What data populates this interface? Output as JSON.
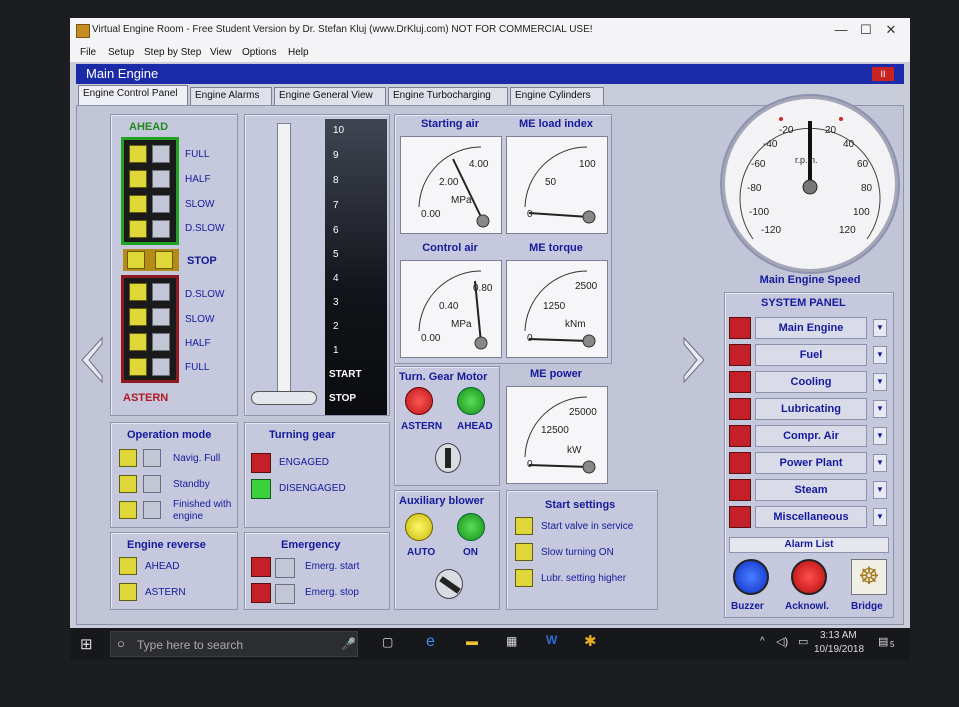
{
  "window": {
    "title": "Virtual Engine Room - Free Student Version by Dr. Stefan Kluj (www.DrKluj.com) NOT FOR COMMERCIAL USE!",
    "minimize": "—",
    "maximize": "☐",
    "close": "✕"
  },
  "menu": [
    "File",
    "Setup",
    "Step by Step",
    "View",
    "Options",
    "Help"
  ],
  "header": {
    "title": "Main Engine",
    "pause": "II"
  },
  "tabs": [
    "Engine Control Panel",
    "Engine Alarms",
    "Engine General View",
    "Engine Turbocharging",
    "Engine Cylinders"
  ],
  "telegraph": {
    "ahead_title": "AHEAD",
    "astern_title": "ASTERN",
    "stop": "STOP",
    "ahead_rows": [
      "FULL",
      "HALF",
      "SLOW",
      "D.SLOW"
    ],
    "astern_rows": [
      "D.SLOW",
      "SLOW",
      "HALF",
      "FULL"
    ]
  },
  "lever": {
    "scale": [
      "10",
      "9",
      "8",
      "7",
      "6",
      "5",
      "4",
      "3",
      "2",
      "1",
      "START",
      "STOP"
    ]
  },
  "gauges": {
    "starting_air": {
      "title": "Starting air",
      "min": "0.00",
      "mid": "2.00",
      "max": "4.00",
      "unit": "MPa"
    },
    "load_index": {
      "title": "ME load index",
      "min": "0",
      "mid": "50",
      "max": "100"
    },
    "control_air": {
      "title": "Control air",
      "min": "0.00",
      "mid": "0.40",
      "max": "0.80",
      "unit": "MPa"
    },
    "torque": {
      "title": "ME torque",
      "min": "0",
      "mid": "1250",
      "max": "2500",
      "unit": "kNm"
    },
    "power": {
      "title": "ME power",
      "min": "0",
      "mid": "12500",
      "max": "25000",
      "unit": "kW"
    }
  },
  "speed_gauge": {
    "title": "Main Engine Speed",
    "unit": "r.p.m.",
    "labels": [
      "-20",
      "20",
      "-40",
      "40",
      "-60",
      "60",
      "-80",
      "80",
      "-100",
      "100",
      "-120",
      "120"
    ]
  },
  "turning_gear_motor": {
    "title": "Turn. Gear Motor",
    "astern": "ASTERN",
    "ahead": "AHEAD"
  },
  "operation_mode": {
    "title": "Operation mode",
    "items": [
      "Navig. Full",
      "Standby",
      "Finished with engine"
    ]
  },
  "turning_gear": {
    "title": "Turning gear",
    "engaged": "ENGAGED",
    "disengaged": "DISENGAGED"
  },
  "engine_reverse": {
    "title": "Engine reverse",
    "ahead": "AHEAD",
    "astern": "ASTERN"
  },
  "emergency": {
    "title": "Emergency",
    "start": "Emerg. start",
    "stop": "Emerg. stop"
  },
  "aux_blower": {
    "title": "Auxiliary blower",
    "auto": "AUTO",
    "on": "ON"
  },
  "start_settings": {
    "title": "Start settings",
    "items": [
      "Start valve in service",
      "Slow turning ON",
      "Lubr. setting higher"
    ]
  },
  "system_panel": {
    "title": "SYSTEM PANEL",
    "items": [
      "Main Engine",
      "Fuel",
      "Cooling",
      "Lubricating",
      "Compr. Air",
      "Power Plant",
      "Steam",
      "Miscellaneous"
    ],
    "alarm_list": "Alarm List",
    "buzzer": "Buzzer",
    "acknowl": "Acknowl.",
    "bridge": "Bridge"
  },
  "taskbar": {
    "search_placeholder": "Type here to search",
    "time": "3:13 AM",
    "date": "10/19/2018",
    "notifications": "5"
  },
  "colors": {
    "header_blue": "#1b2aa6",
    "label_blue": "#141a9c",
    "lamp_yellow": "#dfd63a",
    "lamp_red": "#c3202a",
    "lamp_green": "#3bd03d"
  }
}
